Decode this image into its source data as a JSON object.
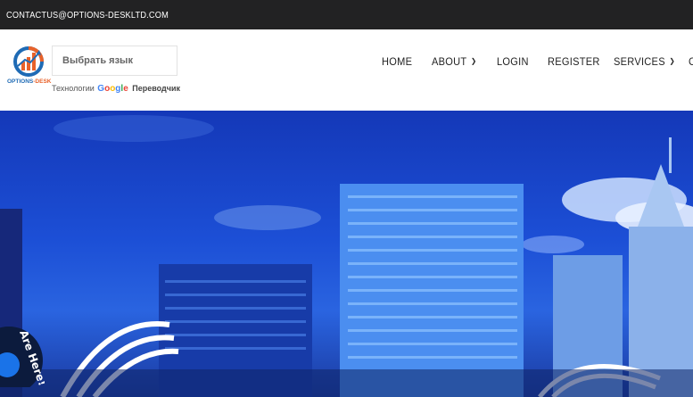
{
  "topbar": {
    "email": "CONTACTUS@OPTIONS-DESKLTD.COM"
  },
  "logo": {
    "name_main": "OPTIONS",
    "name_accent": "-DESK"
  },
  "translate": {
    "select_label": "Выбрать язык",
    "powered_prefix": "Технологии",
    "google_letters": [
      "G",
      "o",
      "o",
      "g",
      "l",
      "e"
    ],
    "powered_suffix": "Переводчик"
  },
  "nav": {
    "home": "HOME",
    "about": "ABOUT",
    "login": "LOGIN",
    "register": "REGISTER",
    "services": "SERVICES",
    "cut_off": "C"
  },
  "badge": {
    "text": "Are Here!"
  },
  "colors": {
    "topbar_bg": "#222223",
    "hero_blue": "#1c4fd6",
    "logo_blue": "#1f6bb5",
    "logo_orange": "#e8622a"
  }
}
